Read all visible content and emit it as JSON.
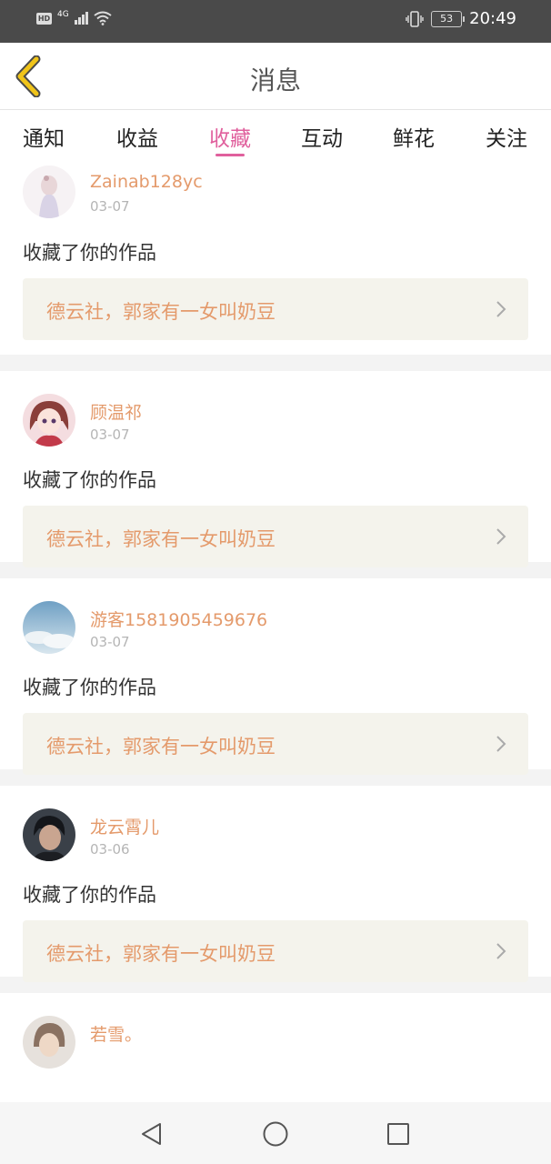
{
  "status_bar": {
    "time": "20:49",
    "battery": "53",
    "hd": "HD",
    "network": "4G",
    "icons": [
      "signal-icon",
      "wifi-icon",
      "vibrate-icon",
      "battery-icon"
    ]
  },
  "header": {
    "title": "消息",
    "back_icon": "chevron-left-icon"
  },
  "tabs": [
    {
      "label": "通知",
      "active": false
    },
    {
      "label": "收益",
      "active": false
    },
    {
      "label": "收藏",
      "active": true
    },
    {
      "label": "互动",
      "active": false
    },
    {
      "label": "鲜花",
      "active": false
    },
    {
      "label": "关注",
      "active": false
    }
  ],
  "notifications": [
    {
      "username": "Zainab128yc",
      "date": "03-07",
      "action": "收藏了你的作品",
      "work_title": "德云社，郭家有一女叫奶豆"
    },
    {
      "username": "顾温祁",
      "date": "03-07",
      "action": "收藏了你的作品",
      "work_title": "德云社，郭家有一女叫奶豆"
    },
    {
      "username": "游客1581905459676",
      "date": "03-07",
      "action": "收藏了你的作品",
      "work_title": "德云社，郭家有一女叫奶豆"
    },
    {
      "username": "龙云霄儿",
      "date": "03-06",
      "action": "收藏了你的作品",
      "work_title": "德云社，郭家有一女叫奶豆"
    },
    {
      "username": "若雪。",
      "date": "",
      "action": "",
      "work_title": ""
    }
  ],
  "colors": {
    "accent": "#e0609d",
    "username": "#e49a6b",
    "back_icon": "#f0c419"
  },
  "nav_bar": {
    "icons": [
      "back-triangle-icon",
      "home-circle-icon",
      "recents-square-icon"
    ]
  }
}
